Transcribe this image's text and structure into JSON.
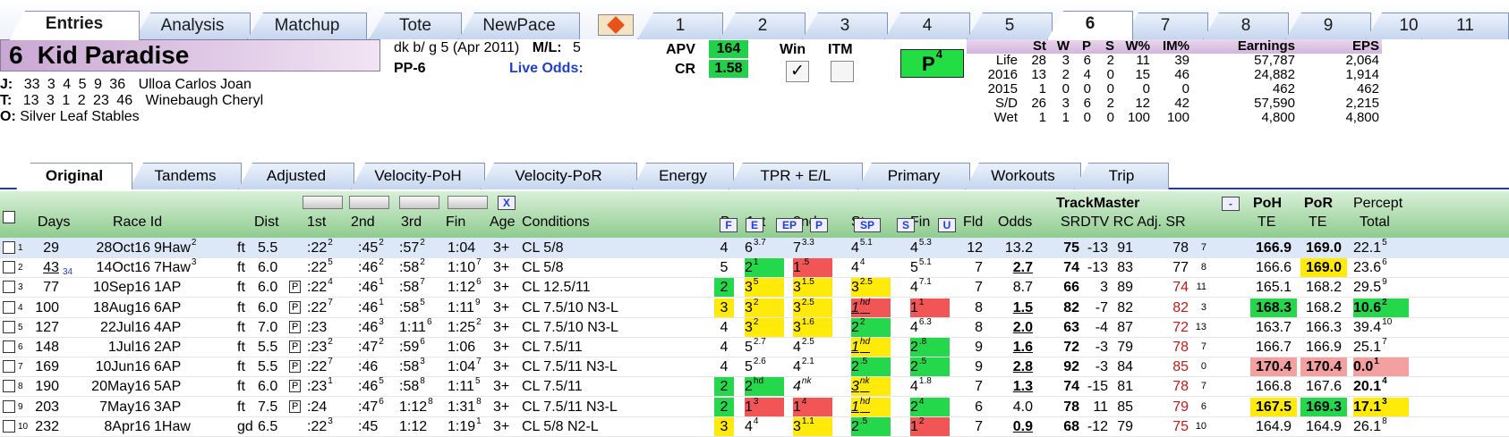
{
  "top_tabs": [
    "Entries",
    "Analysis",
    "Matchup",
    "Tote",
    "NewPace",
    "1",
    "2",
    "3",
    "4",
    "5",
    "6",
    "7",
    "8",
    "9",
    "10",
    "11"
  ],
  "horse": {
    "num": "6",
    "name": "Kid Paradise",
    "desc": "dk b/ g 5  (Apr 2011)",
    "ml_label": "M/L:",
    "ml": "5",
    "pp": "PP-6",
    "live_odds_label": "Live Odds:",
    "jockey_label": "J:",
    "jockey_stats": "33   3   4   5    9   36",
    "jockey": "Ulloa Carlos Joan",
    "trainer_label": "T:",
    "trainer_stats": "13   3   1   2   23   46",
    "trainer": "Winebaugh Cheryl",
    "owner_label": "O:",
    "owner": "Silver Leaf Stables",
    "apv_label": "APV",
    "apv": "164",
    "cr_label": "CR",
    "cr": "1.58",
    "win_label": "Win",
    "itm_label": "ITM",
    "win_check": "✓",
    "p_button": "P",
    "p_sup": "4"
  },
  "stats": {
    "headers": [
      "",
      "St",
      "W",
      "P",
      "S",
      "W%",
      "IM%",
      "Earnings",
      "EPS"
    ],
    "rows": [
      [
        "Life",
        "28",
        "3",
        "6",
        "2",
        "11",
        "39",
        "57,787",
        "2,064"
      ],
      [
        "2016",
        "13",
        "2",
        "4",
        "0",
        "15",
        "46",
        "24,882",
        "1,914"
      ],
      [
        "2015",
        "1",
        "0",
        "0",
        "0",
        "0",
        "0",
        "462",
        "462"
      ],
      [
        "S/D",
        "26",
        "3",
        "6",
        "2",
        "12",
        "42",
        "57,590",
        "2,215"
      ],
      [
        "Wet",
        "1",
        "1",
        "0",
        "0",
        "100",
        "100",
        "4,800",
        "4,800"
      ]
    ]
  },
  "sub_tabs": [
    "Original",
    "Tandems",
    "Adjusted",
    "Velocity-PoH",
    "Velocity-PoR",
    "Energy",
    "TPR + E/L",
    "Primary",
    "Workouts",
    "Trip"
  ],
  "grid_headers": {
    "days": "Days",
    "raceid": "Race Id",
    "dist": "Dist",
    "q1": "1st",
    "q2": "2nd",
    "q3": "3rd",
    "fin": "Fin",
    "age": "Age",
    "cond": "Conditions",
    "br": "Br",
    "c1": "1st",
    "c2": "2nd",
    "str": "Str",
    "cfin": "Fin",
    "fld": "Fld",
    "odds": "Odds",
    "tm": "TrackMaster",
    "tm2": "SRDTV RC  Adj. SR",
    "poh": "PoH",
    "poh2": "TE",
    "por": "PoR",
    "por2": "TE",
    "pct": "Percept",
    "pct2": "Total",
    "btnX": "X",
    "btnF": "F",
    "btnE": "E",
    "btnEP": "EP",
    "btnP": "P",
    "btnSP": "SP",
    "btnS": "S",
    "btnU": "U",
    "btnMinus": "-"
  },
  "rows": [
    {
      "n": "1",
      "days": "29",
      "race": "28Oct16",
      "trk": "9Haw",
      "rs": "2",
      "surf": "ft",
      "dist": "5.5",
      "p": false,
      "q1": ":22",
      "q1s": "2",
      "q2": ":45",
      "q2s": "2",
      "q3": ":57",
      "q3s": "2",
      "fin": "1:04",
      "age": "3+",
      "cond": "CL 5/8",
      "br": "4",
      "c1": "6",
      "c1s": "3.7",
      "c2": "7",
      "c2s": "3.3",
      "str": "4",
      "strs": "5.1",
      "cf": "4",
      "cfs": "5.3",
      "fld": "12",
      "odds": "13.2",
      "sr": "75",
      "dtv": "-13",
      "rc": "91",
      "adj": "78",
      "adjs": "7",
      "poh": "166.9",
      "por": "169.0",
      "pct": "22.1",
      "pcts": "5"
    },
    {
      "n": "2",
      "days": "43",
      "dsub": "34",
      "race": "14Oct16",
      "trk": "7Haw",
      "rs": "3",
      "surf": "ft",
      "dist": "6.0",
      "p": false,
      "q1": ":22",
      "q1s": "5",
      "q2": ":46",
      "q2s": "2",
      "q3": ":58",
      "q3s": "2",
      "fin": "1:10",
      "fins": "7",
      "age": "3+",
      "cond": "CL 5/8",
      "br": "5",
      "c1": "2",
      "c1s": "1",
      "c2": "1",
      "c2s": ".5",
      "str": "4",
      "strs": "4",
      "cf": "5",
      "cfs": "5.1",
      "fld": "7",
      "odds": "2.7",
      "sr": "74",
      "dtv": "-13",
      "rc": "83",
      "adj": "77",
      "adjs": "8",
      "poh": "166.6",
      "por": "169.0",
      "pct": "23.6",
      "pcts": "6"
    },
    {
      "n": "3",
      "days": "77",
      "race": "10Sep16",
      "trk": "1AP",
      "surf": "ft",
      "dist": "6.0",
      "p": true,
      "q1": ":22",
      "q1s": "4",
      "q2": ":46",
      "q2s": "1",
      "q3": ":58",
      "q3s": "7",
      "fin": "1:12",
      "fins": "6",
      "age": "3+",
      "cond": "CL 12.5/11",
      "br": "2",
      "c1": "3",
      "c1s": "5",
      "c2": "3",
      "c2s": "1.5",
      "str": "3",
      "strs": "2.5",
      "cf": "4",
      "cfs": "7.1",
      "fld": "7",
      "odds": "8.7",
      "sr": "66",
      "dtv": "3",
      "rc": "89",
      "adj": "74",
      "adjs": "11",
      "poh": "165.1",
      "por": "168.2",
      "pct": "29.5",
      "pcts": "9"
    },
    {
      "n": "4",
      "days": "100",
      "race": "18Aug16",
      "trk": "6AP",
      "surf": "ft",
      "dist": "6.0",
      "p": true,
      "q1": ":22",
      "q1s": "7",
      "q2": ":46",
      "q2s": "1",
      "q3": ":58",
      "q3s": "5",
      "fin": "1:11",
      "fins": "9",
      "age": "3+",
      "cond": "CL 7.5/10 N3-L",
      "br": "3",
      "c1": "3",
      "c1s": "2",
      "c2": "3",
      "c2s": "2.5",
      "str": "1",
      "strs": "hd",
      "cf": "1",
      "cfs": "1",
      "fld": "8",
      "odds": "1.5",
      "sr": "82",
      "dtv": "-7",
      "rc": "82",
      "adj": "82",
      "adjs": "3",
      "poh": "168.3",
      "por": "168.2",
      "pct": "10.6",
      "pcts": "2"
    },
    {
      "n": "5",
      "days": "127",
      "race": "22Jul16",
      "trk": "4AP",
      "surf": "ft",
      "dist": "7.0",
      "p": true,
      "q1": ":23",
      "q2": ":46",
      "q2s": "3",
      "q3": "1:11",
      "q3s": "6",
      "fin": "1:25",
      "fins": "2",
      "age": "3+",
      "cond": "CL 7.5/10 N3-L",
      "br": "4",
      "c1": "3",
      "c1s": "2",
      "c2": "3",
      "c2s": "1.6",
      "str": "2",
      "strs": "2",
      "cf": "4",
      "cfs": "6.3",
      "fld": "8",
      "odds": "2.0",
      "sr": "63",
      "dtv": "-4",
      "rc": "87",
      "adj": "72",
      "adjs": "13",
      "poh": "163.7",
      "por": "166.3",
      "pct": "39.4",
      "pcts": "10"
    },
    {
      "n": "6",
      "days": "148",
      "race": "1Jul16",
      "trk": "2AP",
      "surf": "ft",
      "dist": "5.5",
      "p": true,
      "q1": ":23",
      "q1s": "2",
      "q2": ":47",
      "q2s": "2",
      "q3": ":59",
      "q3s": "6",
      "fin": "1:06",
      "age": "3+",
      "cond": "CL 7.5/11",
      "br": "4",
      "c1": "5",
      "c1s": "2.7",
      "c2": "4",
      "c2s": "2.5",
      "str": "1",
      "strs": "hd",
      "cf": "2",
      "cfs": ".8",
      "fld": "9",
      "odds": "1.6",
      "sr": "72",
      "dtv": "-3",
      "rc": "79",
      "adj": "78",
      "adjs": "7",
      "poh": "166.7",
      "por": "166.9",
      "pct": "25.1",
      "pcts": "7"
    },
    {
      "n": "7",
      "days": "169",
      "race": "10Jun16",
      "trk": "6AP",
      "surf": "ft",
      "dist": "5.5",
      "p": true,
      "q1": ":22",
      "q1s": "7",
      "q2": ":46",
      "q3": ":58",
      "q3s": "3",
      "fin": "1:04",
      "fins": "7",
      "age": "3+",
      "cond": "CL 7.5/11 N3-L",
      "br": "4",
      "c1": "5",
      "c1s": "2.6",
      "c2": "4",
      "c2s": "2.1",
      "str": "2",
      "strs": ".5",
      "cf": "2",
      "cfs": ".5",
      "fld": "9",
      "odds": "2.8",
      "sr": "92",
      "dtv": "-3",
      "rc": "84",
      "adj": "85",
      "adjs": "0",
      "poh": "170.4",
      "por": "170.4",
      "pct": "0.0",
      "pcts": "1"
    },
    {
      "n": "8",
      "days": "190",
      "race": "20May16",
      "trk": "5AP",
      "surf": "ft",
      "dist": "6.0",
      "p": true,
      "q1": ":23",
      "q1s": "1",
      "q2": ":46",
      "q2s": "5",
      "q3": ":58",
      "q3s": "8",
      "fin": "1:11",
      "fins": "5",
      "age": "3+",
      "cond": "CL 7.5/11",
      "br": "2",
      "c1": "2",
      "c1s": "hd",
      "c2": "4",
      "c2s": "nk",
      "str": "3",
      "strs": "nk",
      "cf": "4",
      "cfs": "1.8",
      "fld": "7",
      "odds": "1.3",
      "sr": "74",
      "dtv": "-15",
      "rc": "81",
      "adj": "78",
      "adjs": "7",
      "poh": "166.8",
      "por": "167.6",
      "pct": "20.1",
      "pcts": "4"
    },
    {
      "n": "9",
      "days": "203",
      "race": "7May16",
      "trk": "3AP",
      "surf": "ft",
      "dist": "7.5",
      "p": true,
      "q1": ":24",
      "q2": ":47",
      "q2s": "6",
      "q3": "1:12",
      "q3s": "8",
      "fin": "1:31",
      "fins": "8",
      "age": "3+",
      "cond": "CL 7.5/11 N3-L",
      "br": "2",
      "c1": "1",
      "c1s": "3",
      "c2": "1",
      "c2s": "4",
      "str": "1",
      "strs": "hd",
      "cf": "2",
      "cfs": "4",
      "fld": "6",
      "odds": "4.0",
      "sr": "78",
      "dtv": "11",
      "rc": "85",
      "adj": "79",
      "adjs": "6",
      "poh": "167.5",
      "por": "169.3",
      "pct": "17.1",
      "pcts": "3"
    },
    {
      "n": "10",
      "days": "232",
      "race": "8Apr16",
      "trk": "1Haw",
      "surf": "gd",
      "dist": "6.5",
      "p": false,
      "q1": ":22",
      "q1s": "3",
      "q2": ":45",
      "q3": "1:12",
      "fin": "1:19",
      "fins": "1",
      "age": "3+",
      "cond": "CL 5/8 N2-L",
      "br": "3",
      "c1": "4",
      "c1s": "4",
      "c2": "3",
      "c2s": "1.1",
      "str": "2",
      "strs": ".5",
      "cf": "1",
      "cfs": "2",
      "fld": "7",
      "odds": "0.9",
      "sr": "68",
      "dtv": "-12",
      "rc": "79",
      "adj": "75",
      "adjs": "10",
      "poh": "164.9",
      "por": "164.9",
      "pct": "26.1",
      "pcts": "8"
    }
  ],
  "colors": {
    "yellow": "#ffea0a",
    "green": "#24d74b",
    "red": "#f25555",
    "pink": "#f5a0a0"
  }
}
